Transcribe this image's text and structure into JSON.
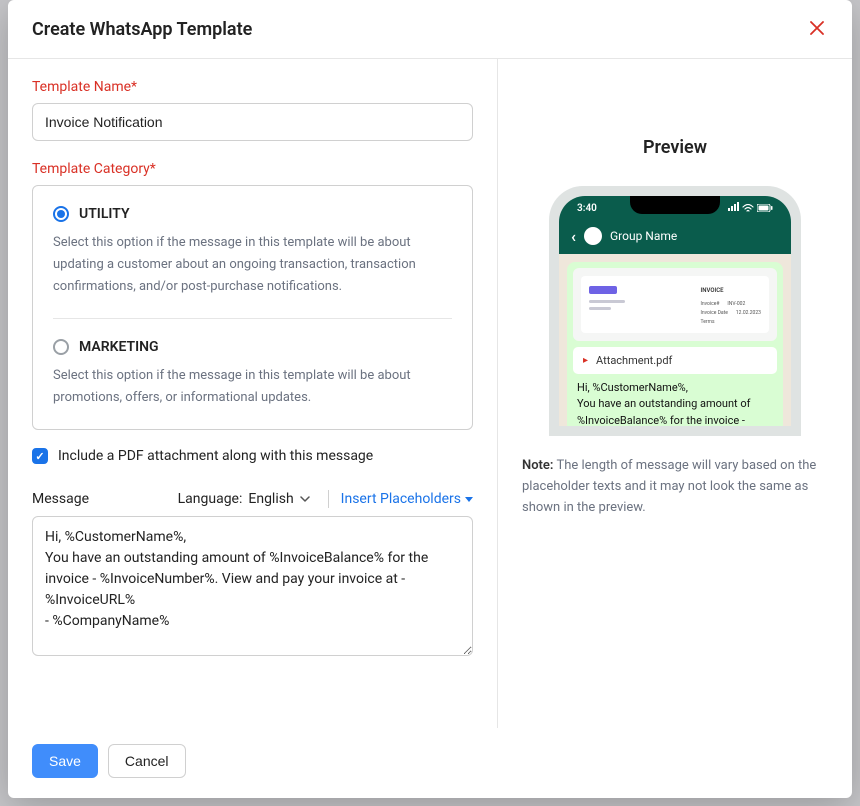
{
  "modal": {
    "title": "Create WhatsApp Template"
  },
  "form": {
    "templateNameLabel": "Template Name*",
    "templateNameValue": "Invoice Notification",
    "templateCategoryLabel": "Template Category*",
    "categories": [
      {
        "id": "utility",
        "title": "UTILITY",
        "desc": "Select this option if the message in this template will be about updating a customer about an ongoing transaction, transaction confirmations, and/or post-purchase notifications.",
        "checked": true
      },
      {
        "id": "marketing",
        "title": "MARKETING",
        "desc": "Select this option if the message in this template will be about promotions, offers, or informational updates.",
        "checked": false
      }
    ],
    "includePdf": {
      "label": "Include a PDF attachment along with this message",
      "checked": true
    },
    "messageLabel": "Message",
    "languageLabel": "Language:",
    "languageValue": "English",
    "insertPlaceholdersLabel": "Insert Placeholders",
    "messageValue": "Hi, %CustomerName%,\nYou have an outstanding amount of %InvoiceBalance% for the invoice - %InvoiceNumber%. View and pay your invoice at - %InvoiceURL%\n- %CompanyName%"
  },
  "preview": {
    "title": "Preview",
    "time": "3:40",
    "groupName": "Group Name",
    "invoiceTitle": "INVOICE",
    "invoiceNoLabel": "Invoice#",
    "invoiceNoValue": "INV-002",
    "invoiceDateLabel": "Invoice Date",
    "invoiceDateValue": "12.02.2023",
    "termsLabel": "Terms",
    "attachmentName": "Attachment.pdf",
    "bubbleText": "Hi, %CustomerName%,\nYou have an outstanding amount of %InvoiceBalance% for the invoice - %InvoiceNumber%. View and pay",
    "noteBold": "Note:",
    "noteText": " The length of message will vary based on the placeholder texts and it may not look the same as shown in the preview."
  },
  "footer": {
    "save": "Save",
    "cancel": "Cancel"
  }
}
